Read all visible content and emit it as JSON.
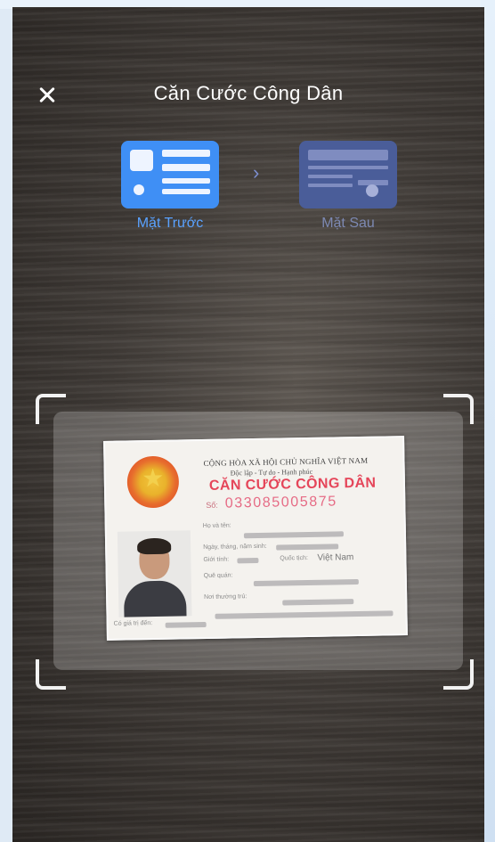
{
  "header": {
    "title": "Căn Cước Công Dân",
    "close_icon": "close-icon"
  },
  "steps": {
    "front": {
      "label": "Mặt Trước",
      "icon": "id-card-front-icon",
      "color": "#3f8ff5"
    },
    "arrow": "›",
    "back": {
      "label": "Mặt Sau",
      "icon": "id-card-back-icon",
      "color": "#4a5d99"
    }
  },
  "card": {
    "header_line1": "CỘNG HÒA XÃ HỘI CHỦ NGHĨA VIỆT NAM",
    "header_line2": "Độc lập - Tự do - Hạnh phúc",
    "title": "CĂN CƯỚC CÔNG DÂN",
    "number_label": "Số:",
    "number": "033085005875",
    "field_name": "Họ và tên:",
    "field_dob": "Ngày, tháng, năm sinh:",
    "field_sex": "Giới tính:",
    "field_nationality": "Quốc tịch:",
    "nationality_value": "Việt Nam",
    "field_hometown": "Quê quán:",
    "field_residence": "Nơi thường trú:",
    "field_expiry": "Có giá trị đến:"
  }
}
